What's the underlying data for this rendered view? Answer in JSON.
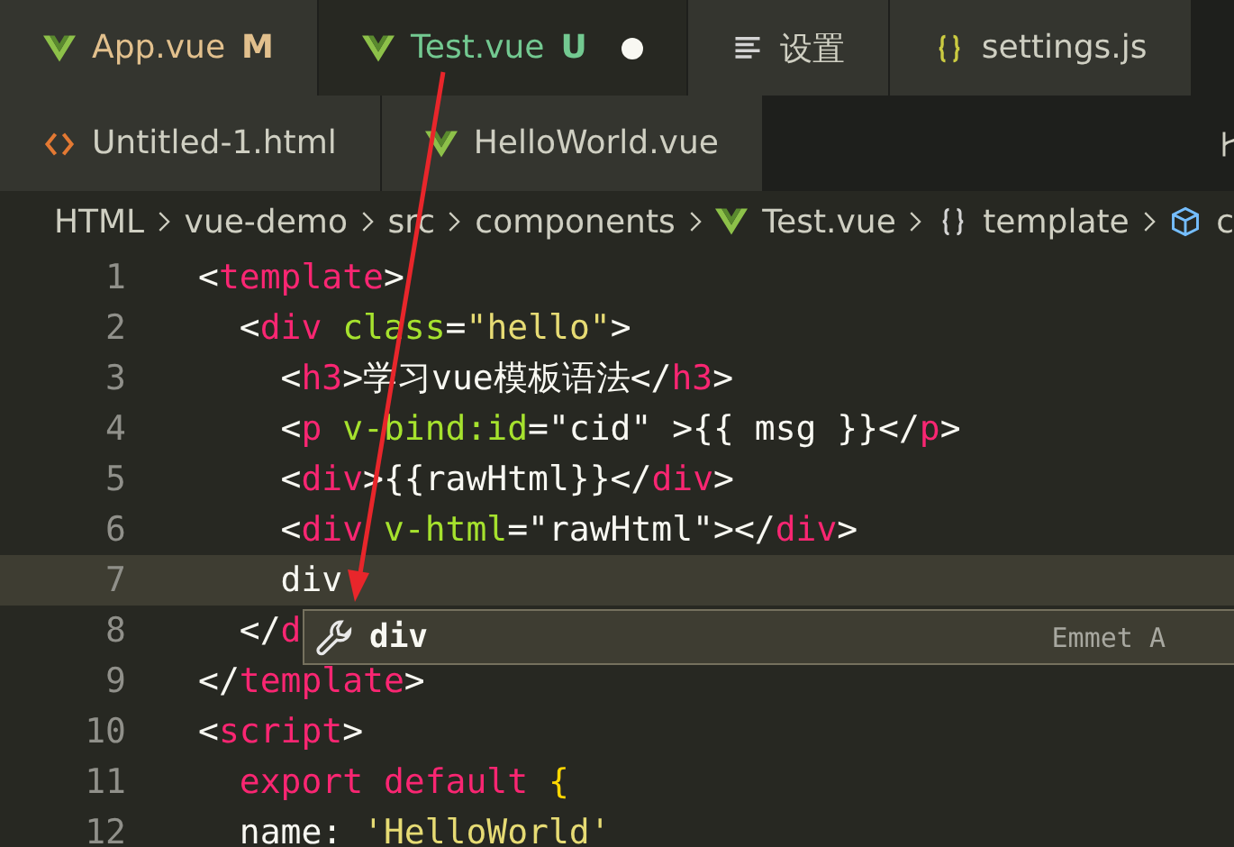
{
  "tab_rows": [
    {
      "tabs": [
        {
          "label": "App.vue",
          "kind": "vue",
          "status": "M",
          "color": "#e2c08d",
          "selected": false,
          "dirty": false
        },
        {
          "label": "Test.vue",
          "kind": "vue",
          "status": "U",
          "color": "#73c991",
          "selected": true,
          "dirty": true
        },
        {
          "label": "设置",
          "kind": "settings",
          "selected": false,
          "dirty": false
        },
        {
          "label": "settings.js",
          "kind": "json",
          "selected": false,
          "dirty": false
        }
      ]
    },
    {
      "tabs": [
        {
          "label": "Untitled-1.html",
          "kind": "html",
          "selected": false,
          "dirty": false
        },
        {
          "label": "HelloWorld.vue",
          "kind": "vue",
          "selected": false,
          "dirty": false
        }
      ]
    }
  ],
  "breadcrumb": [
    {
      "label": "HTML"
    },
    {
      "label": "vue-demo"
    },
    {
      "label": "src"
    },
    {
      "label": "components"
    },
    {
      "label": "Test.vue",
      "kind": "vue"
    },
    {
      "label": "template",
      "kind": "braces"
    },
    {
      "label": "c",
      "kind": "cube"
    }
  ],
  "editor": {
    "lines": [
      {
        "number": "1",
        "current": false,
        "tokens": [
          {
            "kind": "punct",
            "text": "<"
          },
          {
            "kind": "tag",
            "text": "template"
          },
          {
            "kind": "punct",
            "text": ">"
          }
        ]
      },
      {
        "number": "2",
        "current": false,
        "tokens": [
          {
            "kind": "punct",
            "text": "  <"
          },
          {
            "kind": "tag",
            "text": "div"
          },
          {
            "kind": "attr",
            "text": " class"
          },
          {
            "kind": "punct",
            "text": "="
          },
          {
            "kind": "string",
            "text": "\"hello\""
          },
          {
            "kind": "punct",
            "text": ">"
          }
        ]
      },
      {
        "number": "3",
        "current": false,
        "tokens": [
          {
            "kind": "punct",
            "text": "    <"
          },
          {
            "kind": "tag",
            "text": "h3"
          },
          {
            "kind": "punct",
            "text": ">学习vue模板语法</"
          },
          {
            "kind": "tag",
            "text": "h3"
          },
          {
            "kind": "punct",
            "text": ">"
          }
        ]
      },
      {
        "number": "4",
        "current": false,
        "tokens": [
          {
            "kind": "punct",
            "text": "    <"
          },
          {
            "kind": "tag",
            "text": "p"
          },
          {
            "kind": "attr",
            "text": " v-bind:id"
          },
          {
            "kind": "punct",
            "text": "=\"cid\" >{{ msg }}</"
          },
          {
            "kind": "tag",
            "text": "p"
          },
          {
            "kind": "punct",
            "text": ">"
          }
        ]
      },
      {
        "number": "5",
        "current": false,
        "tokens": [
          {
            "kind": "punct",
            "text": "    <"
          },
          {
            "kind": "tag",
            "text": "div"
          },
          {
            "kind": "punct",
            "text": ">{{rawHtml}}</"
          },
          {
            "kind": "tag",
            "text": "div"
          },
          {
            "kind": "punct",
            "text": ">"
          }
        ]
      },
      {
        "number": "6",
        "current": false,
        "tokens": [
          {
            "kind": "punct",
            "text": "    <"
          },
          {
            "kind": "tag",
            "text": "div"
          },
          {
            "kind": "attr",
            "text": " v-html"
          },
          {
            "kind": "punct",
            "text": "=\"rawHtml\"></"
          },
          {
            "kind": "tag",
            "text": "div"
          },
          {
            "kind": "punct",
            "text": ">"
          }
        ]
      },
      {
        "number": "7",
        "current": true,
        "tokens": [
          {
            "kind": "punct",
            "text": "    div"
          }
        ]
      },
      {
        "number": "8",
        "current": false,
        "tokens": [
          {
            "kind": "punct",
            "text": "  </"
          },
          {
            "kind": "tag",
            "text": "d"
          }
        ]
      },
      {
        "number": "9",
        "current": false,
        "tokens": [
          {
            "kind": "punct",
            "text": "</"
          },
          {
            "kind": "tag",
            "text": "template"
          },
          {
            "kind": "punct",
            "text": ">"
          }
        ]
      },
      {
        "number": "10",
        "current": false,
        "tokens": [
          {
            "kind": "punct",
            "text": "<"
          },
          {
            "kind": "tag",
            "text": "script"
          },
          {
            "kind": "punct",
            "text": ">"
          }
        ]
      },
      {
        "number": "11",
        "current": false,
        "tokens": [
          {
            "kind": "keyword",
            "text": "  export"
          },
          {
            "kind": "keyword",
            "text": " default"
          },
          {
            "kind": "brace",
            "text": " {"
          }
        ]
      },
      {
        "number": "12",
        "current": false,
        "tokens": [
          {
            "kind": "punct",
            "text": "  name: "
          },
          {
            "kind": "string",
            "text": "'HelloWorld'"
          }
        ]
      }
    ],
    "suggestion": {
      "label": "div",
      "detail": "Emmet A"
    }
  }
}
